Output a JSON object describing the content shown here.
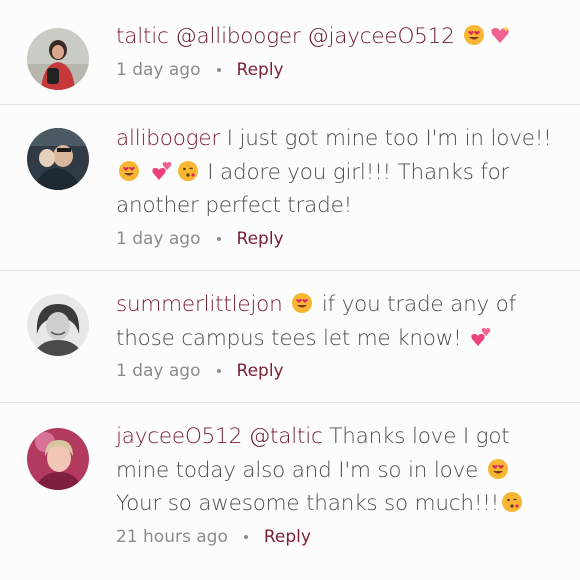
{
  "comments": [
    {
      "username": "taltic",
      "mentions": "@allibooger @jayceeO512",
      "text": "",
      "time": "1 day ago",
      "reply_label": "Reply"
    },
    {
      "username": "allibooger",
      "text_a": "I just got mine too I'm in love!!",
      "text_b": "I adore you girl!!! Thanks for another perfect trade!",
      "time": "1 day ago",
      "reply_label": "Reply"
    },
    {
      "username": "summerlittlejon",
      "text_a": "if you trade any of those campus tees let me know!",
      "time": "1 day ago",
      "reply_label": "Reply"
    },
    {
      "username": "jayceeO512",
      "mentions": "@taltic",
      "text_a": "Thanks love I got mine today also and I'm so in love",
      "text_b": "Your so awesome thanks so much!!!",
      "time": "21 hours ago",
      "reply_label": "Reply"
    }
  ],
  "colors": {
    "username": "#7a2234",
    "body_text": "#4d4d4d",
    "meta_text": "#8c8c8c",
    "divider": "#e4e4e4"
  },
  "icons": [
    "heart-eyes-emoji",
    "sparkling-heart-emoji",
    "two-hearts-emoji",
    "kissing-emoji"
  ]
}
